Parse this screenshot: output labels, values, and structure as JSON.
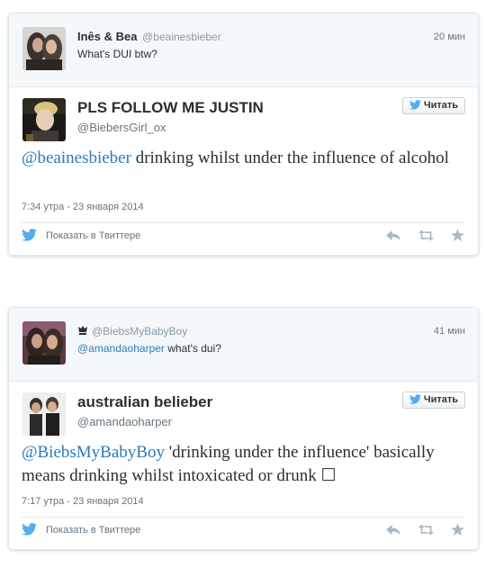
{
  "tweets": [
    {
      "context": {
        "name": "Inês & Bea",
        "handle": "@beainesbieber",
        "text": "What's DUI btw?",
        "time": "20 мин"
      },
      "name": "PLS FOLLOW ME JUSTIN",
      "handle": "@BiebersGirl_ox",
      "follow_label": "Читать",
      "text_mention": "@beainesbieber",
      "text_body": " drinking whilst under the influence of alcohol",
      "date": "7:34 утра - 23 января 2014",
      "view_label": "Показать в Твиттере"
    },
    {
      "context": {
        "handle": "@BiebsMyBabyBoy",
        "mention": "@amandaoharper",
        "text": " what's dui?",
        "time": "41 мин"
      },
      "name": "australian belieber",
      "handle": "@amandaoharper",
      "follow_label": "Читать",
      "text_mention": "@BiebsMyBabyBoy",
      "text_body": " 'drinking under the influence' basically means drinking whilst intoxicated or drunk ☐",
      "date": "7:17 утра - 23 января 2014",
      "view_label": "Показать в Твиттере"
    }
  ],
  "colors": {
    "link": "#2b7bb9",
    "twitter_blue": "#55acee",
    "muted": "#66757f",
    "action_grey": "#aab8c2"
  },
  "icons": {
    "bird": "twitter-bird-icon",
    "reply": "reply-icon",
    "retweet": "retweet-icon",
    "favorite": "star-icon",
    "crown": "crown-icon"
  }
}
